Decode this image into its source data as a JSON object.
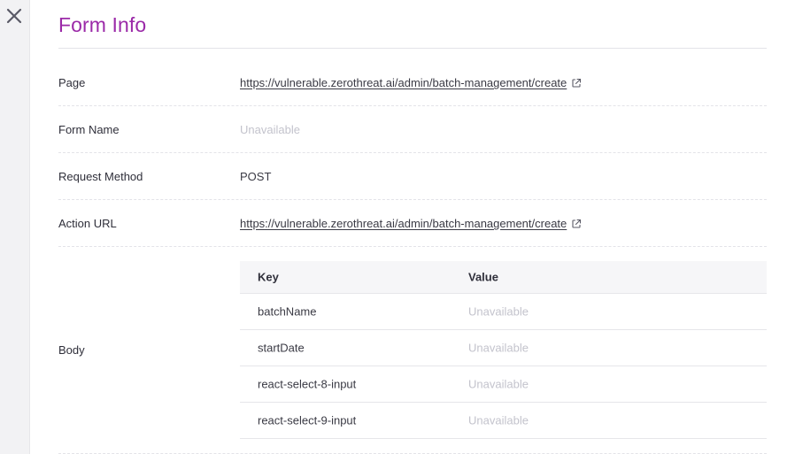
{
  "panel": {
    "title": "Form Info"
  },
  "rows": {
    "page": {
      "label": "Page",
      "value": "https://vulnerable.zerothreat.ai/admin/batch-management/create"
    },
    "form_name": {
      "label": "Form Name",
      "value": "Unavailable"
    },
    "request_method": {
      "label": "Request Method",
      "value": "POST"
    },
    "action_url": {
      "label": "Action URL",
      "value": "https://vulnerable.zerothreat.ai/admin/batch-management/create"
    },
    "body": {
      "label": "Body"
    }
  },
  "body_table": {
    "headers": {
      "key": "Key",
      "value": "Value"
    },
    "rows": [
      {
        "key": "batchName",
        "value": "Unavailable"
      },
      {
        "key": "startDate",
        "value": "Unavailable"
      },
      {
        "key": "react-select-8-input",
        "value": "Unavailable"
      },
      {
        "key": "react-select-9-input",
        "value": "Unavailable"
      }
    ]
  },
  "icons": {
    "close": "close-icon",
    "external_link": "external-link-icon"
  },
  "colors": {
    "title": "#9b2aa8",
    "muted_text": "#c3c3cc",
    "rail_bg": "#f2f2f4"
  }
}
